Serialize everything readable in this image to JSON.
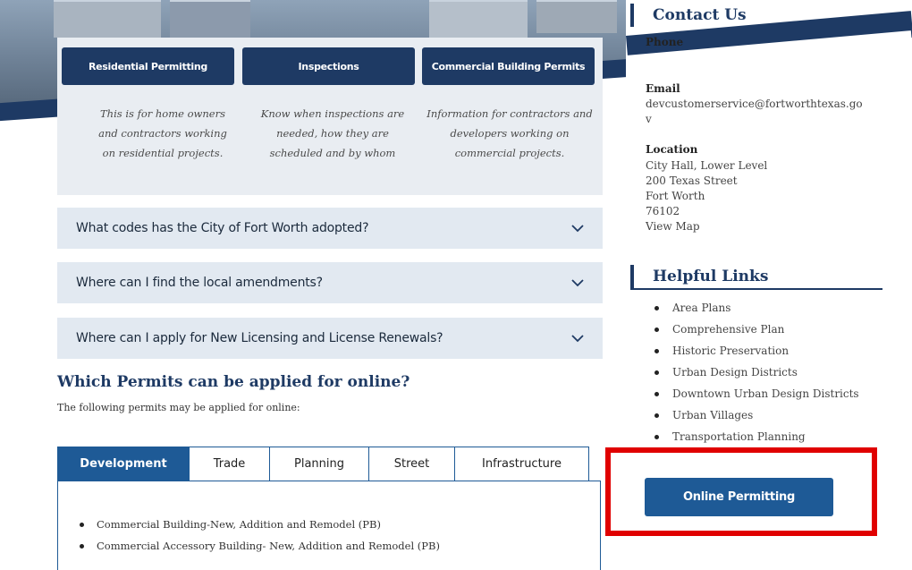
{
  "cards": [
    {
      "button": "Residential Permitting",
      "desc": "This is for home owners and contractors working on residential projects."
    },
    {
      "button": "Inspections",
      "desc": "Know when inspections are needed, how they are scheduled and by whom"
    },
    {
      "button": "Commercial Building Permits",
      "desc": "Information for contractors and developers working on commercial projects."
    }
  ],
  "faq": [
    {
      "question": "What codes has the City of Fort Worth adopted?"
    },
    {
      "question": "Where can I find the local amendments?"
    },
    {
      "question": "Where can I apply for New Licensing and License Renewals?"
    }
  ],
  "permits_section": {
    "title": "Which Permits can be applied for online?",
    "subtitle": "The following permits may be applied for online:"
  },
  "tabs": [
    "Development",
    "Trade",
    "Planning",
    "Street",
    "Infrastructure"
  ],
  "active_tab": "Development",
  "tab_items": [
    "Commercial Building-New, Addition and Remodel (PB)",
    "Commercial Accessory Building- New, Addition and Remodel (PB)"
  ],
  "contact": {
    "title": "Contact Us",
    "phone_label": "Phone",
    "email_label": "Email",
    "email": "devcustomerservice@fortworthtexas.go",
    "email_wrap": "v",
    "location_label": "Location",
    "address_line1": "City Hall, Lower Level",
    "address_line2": "200 Texas Street",
    "city": "Fort Worth",
    "zip": "76102",
    "map_link": "View Map"
  },
  "helpful_links": {
    "title": "Helpful Links",
    "items": [
      "Area Plans",
      "Comprehensive Plan",
      "Historic Preservation",
      "Urban Design Districts",
      "Downtown Urban Design Districts",
      "Urban Villages",
      "Transportation Planning"
    ]
  },
  "online_permitting": "Online Permitting",
  "colors": {
    "navy": "#1e3a64",
    "tab_blue": "#1e5a96",
    "highlight_red": "#e00000",
    "panel_bg": "#e9edf2",
    "accordion_bg": "#e2e9f1"
  }
}
